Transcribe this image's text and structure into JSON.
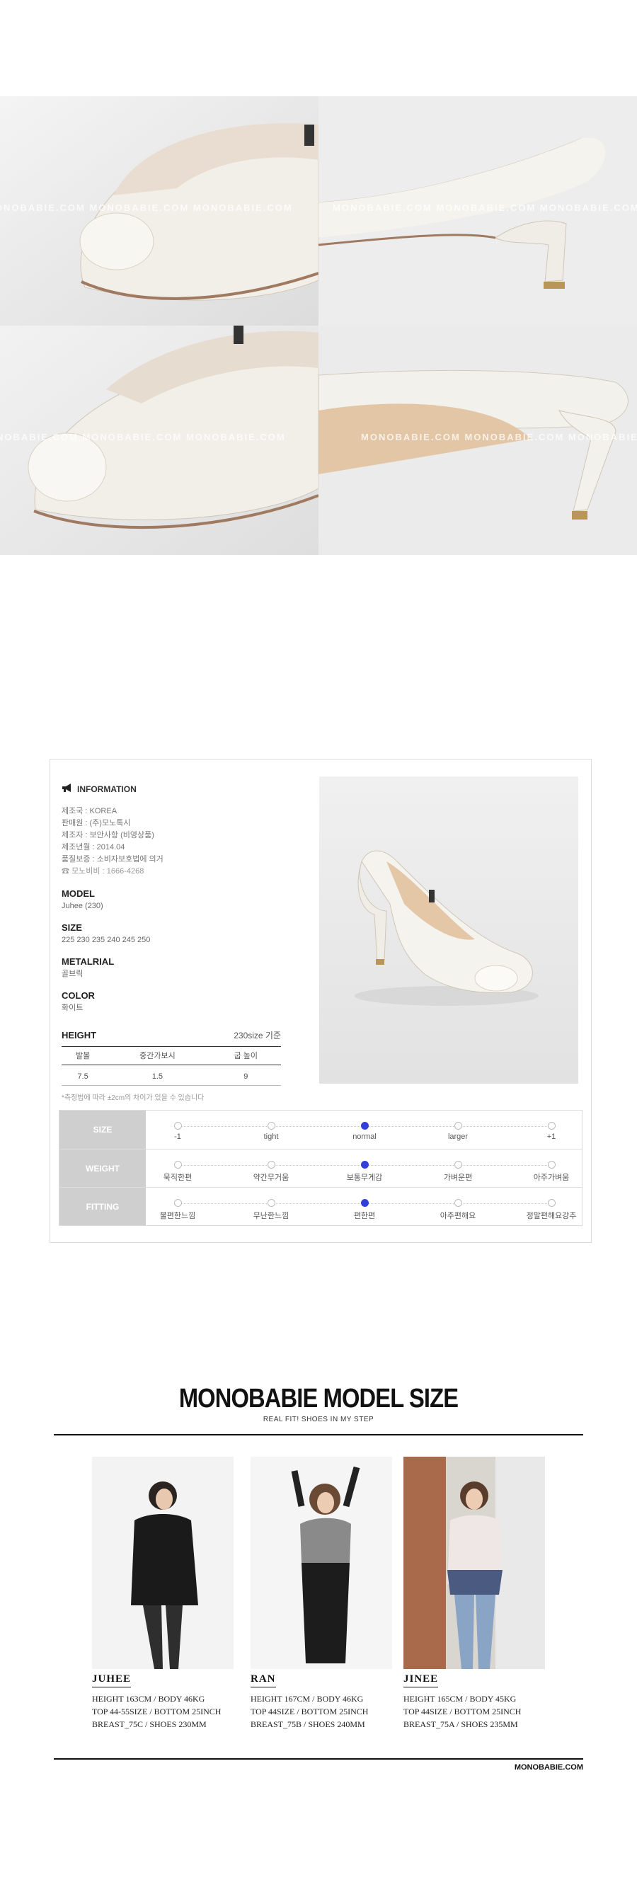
{
  "photos": {
    "watermark": "MONOBABIE.COM MONOBABIE.COM MONOBABIE.COM",
    "items": [
      {
        "name": "toe-closeup-left"
      },
      {
        "name": "heel-side-right"
      },
      {
        "name": "toe-front-left"
      },
      {
        "name": "heel-back-right"
      }
    ]
  },
  "info": {
    "heading": "INFORMATION",
    "rows": [
      "제조국 : KOREA",
      "판매원 : (주)모노톡시",
      "제조자 : 보안사항 (비영상품)",
      "제조년월 : 2014.04",
      "품질보증 : 소비자보호법에 의거"
    ],
    "cs": "모노비비 : 1666-4268",
    "model_label": "MODEL",
    "model_value": "Juhee (230)",
    "size_label": "SIZE",
    "size_value": "225 230 235 240 245 250",
    "material_label": "METALRIAL",
    "material_value": "골브릭",
    "color_label": "COLOR",
    "color_value": "화이트",
    "height_label": "HEIGHT",
    "height_note": "230size 기준",
    "height_headers": [
      "발볼",
      "중간가보시",
      "굽 높이"
    ],
    "height_values": [
      "7.5",
      "1.5",
      "9"
    ],
    "height_footnote": "*측정법에 따라 ±2cm의 차이가 있을 수 있습니다"
  },
  "fit": {
    "rows": [
      {
        "label": "SIZE",
        "options": [
          "-1",
          "tight",
          "normal",
          "larger",
          "+1"
        ],
        "selected": 2
      },
      {
        "label": "WEIGHT",
        "options": [
          "묵직한편",
          "약간무거움",
          "보통무게감",
          "가벼운편",
          "아주가벼움"
        ],
        "selected": 2
      },
      {
        "label": "FITTING",
        "options": [
          "불편한느낌",
          "무난한느낌",
          "편한편",
          "아주편해요",
          "정말편해요강추"
        ],
        "selected": 2
      }
    ]
  },
  "model_section": {
    "title": "MONOBABIE MODEL SIZE",
    "subtitle": "REAL FIT! SHOES IN MY STEP",
    "models": [
      {
        "name": "JUHEE",
        "lines": [
          "HEIGHT 163CM / BODY 46KG",
          "TOP 44-55SIZE / BOTTOM 25INCH",
          "BREAST_75C / SHOES 230MM"
        ]
      },
      {
        "name": "RAN",
        "lines": [
          "HEIGHT 167CM / BODY 46KG",
          "TOP 44SIZE / BOTTOM 25INCH",
          "BREAST_75B / SHOES 240MM"
        ]
      },
      {
        "name": "JINEE",
        "lines": [
          "HEIGHT 165CM / BODY 45KG",
          "TOP 44SIZE / BOTTOM 25INCH",
          "BREAST_75A / SHOES 235MM"
        ]
      }
    ],
    "site": "MONOBABIE.COM"
  }
}
